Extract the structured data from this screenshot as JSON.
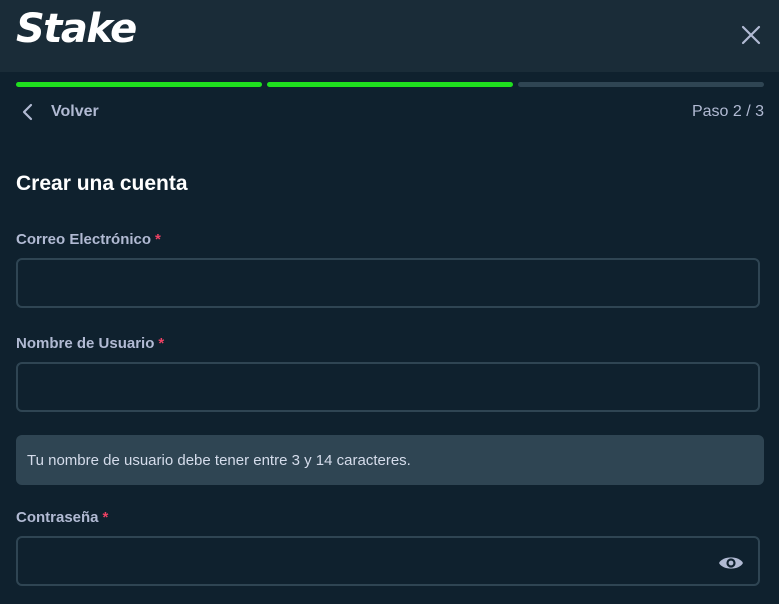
{
  "header": {
    "logo_text": "Stake",
    "close_icon": "close-icon"
  },
  "progress": {
    "current_step": 2,
    "total_steps": 3,
    "active_color": "#1fe01f",
    "inactive_color": "#2f4553"
  },
  "nav": {
    "back_label": "Volver",
    "back_icon": "chevron-left-icon",
    "step_label": "Paso 2 / 3"
  },
  "form": {
    "title": "Crear una cuenta",
    "required_mark": "*",
    "email": {
      "label": "Correo Electrónico",
      "value": "",
      "placeholder": ""
    },
    "username": {
      "label": "Nombre de Usuario",
      "value": "",
      "placeholder": ""
    },
    "username_hint": "Tu nombre de usuario debe tener entre 3 y 14 caracteres.",
    "password": {
      "label": "Contraseña",
      "value": "",
      "placeholder": "",
      "toggle_icon": "eye-icon"
    }
  },
  "colors": {
    "background": "#0f212e",
    "header": "#1a2c38",
    "required": "#ed4163"
  }
}
